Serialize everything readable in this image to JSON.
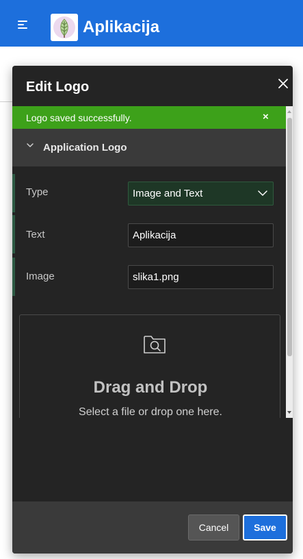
{
  "header": {
    "title": "Aplikacija",
    "menu_icon": "hamburger-menu-icon",
    "logo_icon": "leaf-logo-icon",
    "background": "#1d6fdc"
  },
  "dialog": {
    "title": "Edit Logo",
    "close_icon": "close-icon",
    "alert": {
      "message": "Logo saved successfully.",
      "close_label": "×",
      "color": "#3da11a"
    },
    "region": {
      "title": "Application Logo",
      "collapse_icon": "chevron-down-icon"
    },
    "fields": {
      "type": {
        "label": "Type",
        "value": "Image and Text"
      },
      "text": {
        "label": "Text",
        "value": "Aplikacija"
      },
      "image": {
        "label": "Image",
        "value": "slika1.png"
      }
    },
    "dropzone": {
      "icon": "folder-search-icon",
      "title": "Drag and Drop",
      "subtitle": "Select a file or drop one here."
    },
    "footer": {
      "cancel_label": "Cancel",
      "save_label": "Save"
    }
  }
}
